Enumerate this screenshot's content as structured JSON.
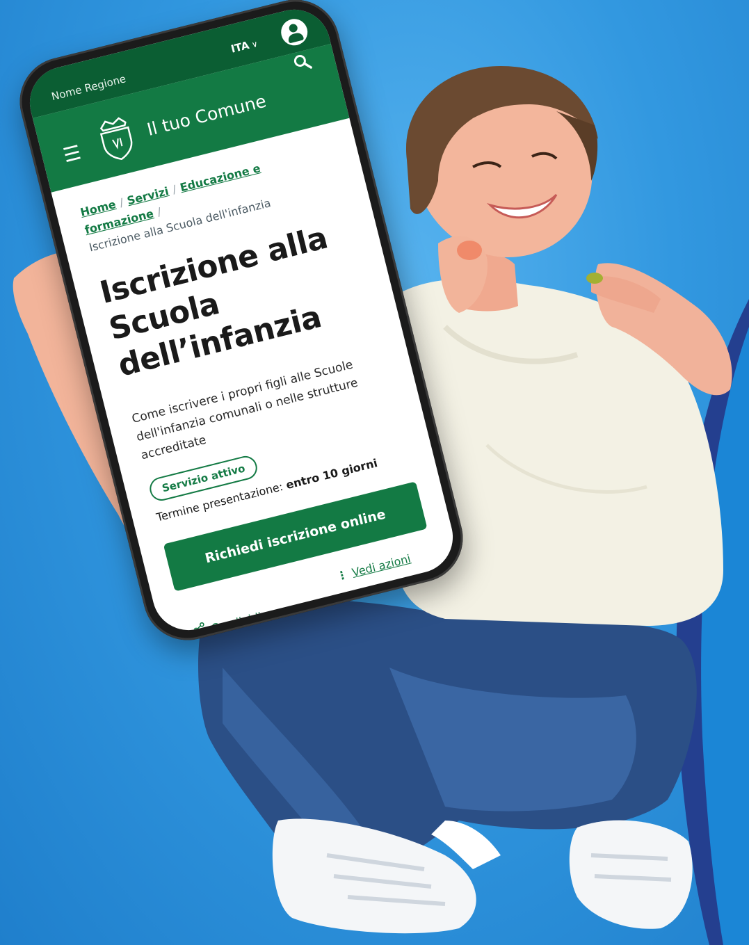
{
  "colors": {
    "background": "#2f93db",
    "brand_dark": "#0b5e33",
    "brand": "#137a44",
    "accent_curve": "#243f8f"
  },
  "topbar": {
    "region": "Nome Regione",
    "language": "ITA",
    "language_icon": "chevron-down-icon",
    "account_icon": "user-icon"
  },
  "header": {
    "menu_icon": "hamburger-icon",
    "crest_icon": "crest-icon",
    "site_name": "Il tuo Comune",
    "search_icon": "search-icon"
  },
  "breadcrumb": {
    "items": [
      "Home",
      "Servizi",
      "Educazione e formazione"
    ],
    "current": "Iscrizione alla Scuola dell'infanzia"
  },
  "page": {
    "title_line1": "Iscrizione alla",
    "title_line2": "Scuola dell’infanzia",
    "description": "Come iscrivere i propri figli alle Scuole dell'infanzia comunali o nelle strutture accreditate",
    "status_badge": "Servizio attivo",
    "deadline_label": "Termine presentazione:",
    "deadline_value": "entro 10 giorni",
    "cta_label": "Richiedi iscrizione online",
    "share_label": "Condividi",
    "share_icon": "share-icon",
    "more_label": "Vedi azioni",
    "more_icon": "kebab-icon"
  }
}
